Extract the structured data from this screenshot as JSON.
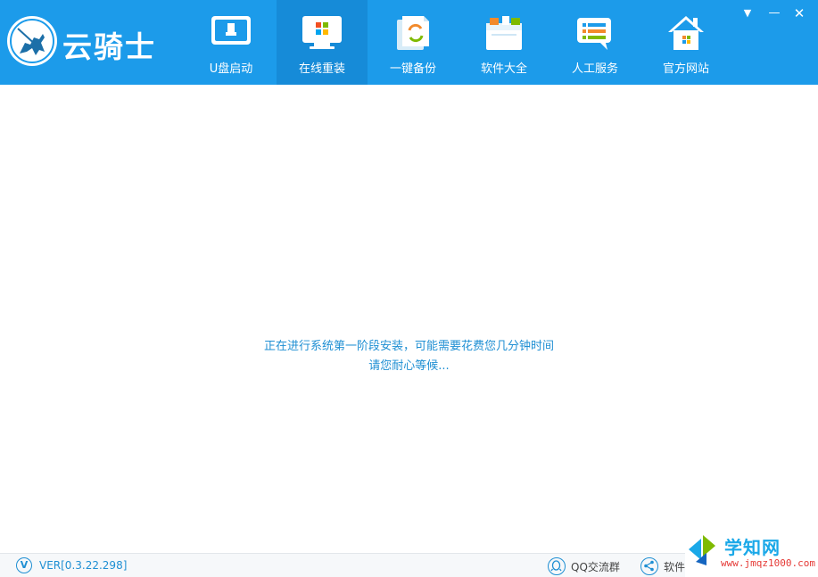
{
  "app": {
    "logo_text": "云骑士"
  },
  "nav": {
    "items": [
      {
        "label": "U盘启动",
        "icon": "usb-drive-icon",
        "active": false
      },
      {
        "label": "在线重装",
        "icon": "monitor-windows-icon",
        "active": true
      },
      {
        "label": "一键备份",
        "icon": "backup-icon",
        "active": false
      },
      {
        "label": "软件大全",
        "icon": "software-box-icon",
        "active": false
      },
      {
        "label": "人工服务",
        "icon": "chat-support-icon",
        "active": false
      },
      {
        "label": "官方网站",
        "icon": "home-icon",
        "active": false
      }
    ]
  },
  "window": {
    "menu_glyph": "▼",
    "minimize_glyph": "—",
    "close_glyph": "✕"
  },
  "main": {
    "status_line1": "正在进行系统第一阶段安装，可能需要花费您几分钟时间",
    "status_line2": "请您耐心等候..."
  },
  "footer": {
    "ver_badge": "V",
    "version": "VER[0.3.22.298]",
    "qq_group": "QQ交流群",
    "share": "软件分"
  },
  "watermark": {
    "title": "学知网",
    "url": "www.jmqz1000.com"
  },
  "colors": {
    "header_bg": "#1c9bea",
    "nav_active_bg": "#168bd8",
    "status_text": "#1f8fd3"
  }
}
